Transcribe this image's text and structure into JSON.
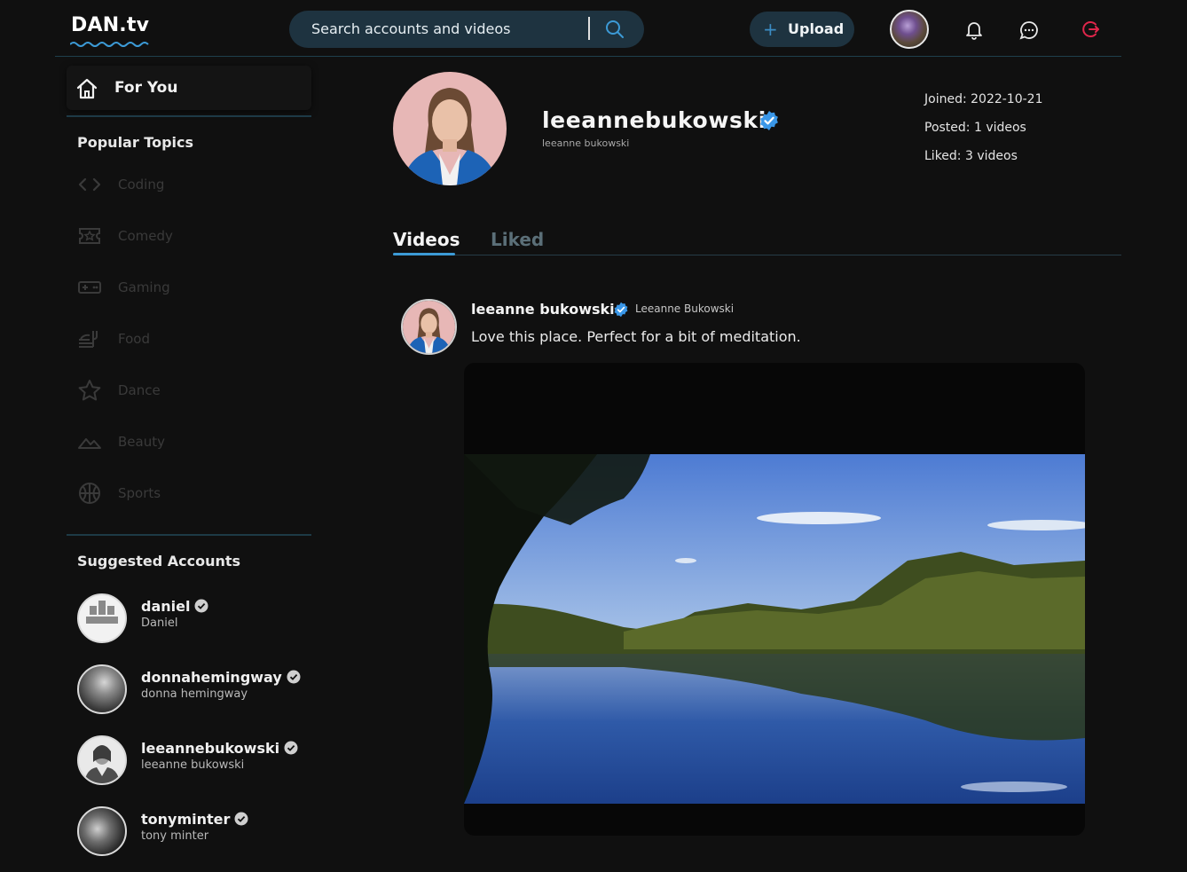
{
  "app": {
    "logo": "DAN.tv",
    "accent_color": "#3c9ad6"
  },
  "header": {
    "search_placeholder": "Search accounts and videos",
    "upload_label": "Upload",
    "icons": [
      "search-icon",
      "plus-icon",
      "bell-icon",
      "messages-icon",
      "logout-icon"
    ]
  },
  "sidebar": {
    "for_you_label": "For You",
    "popular_topics_title": "Popular Topics",
    "topics": [
      {
        "label": "Coding",
        "icon": "code-icon"
      },
      {
        "label": "Comedy",
        "icon": "ticket-icon"
      },
      {
        "label": "Gaming",
        "icon": "gamepad-icon"
      },
      {
        "label": "Food",
        "icon": "food-icon"
      },
      {
        "label": "Dance",
        "icon": "star-icon"
      },
      {
        "label": "Beauty",
        "icon": "mountain-icon"
      },
      {
        "label": "Sports",
        "icon": "basketball-icon"
      }
    ],
    "suggested_title": "Suggested Accounts",
    "accounts": [
      {
        "username": "daniel",
        "display_name": "Daniel"
      },
      {
        "username": "donnahemingway",
        "display_name": "donna hemingway"
      },
      {
        "username": "leeannebukowski",
        "display_name": "leeanne bukowski"
      },
      {
        "username": "tonyminter",
        "display_name": "tony minter"
      }
    ]
  },
  "profile": {
    "username": "leeannebukowski",
    "display_name": "leeanne bukowski",
    "joined": "Joined: 2022-10-21",
    "posted": "Posted: 1 videos",
    "liked": "Liked: 3 videos"
  },
  "tabs": {
    "videos": "Videos",
    "liked": "Liked"
  },
  "post": {
    "author_name": "leeanne bukowski",
    "author_display": "Leeanne Bukowski",
    "caption": "Love this place. Perfect for a bit of meditation."
  }
}
